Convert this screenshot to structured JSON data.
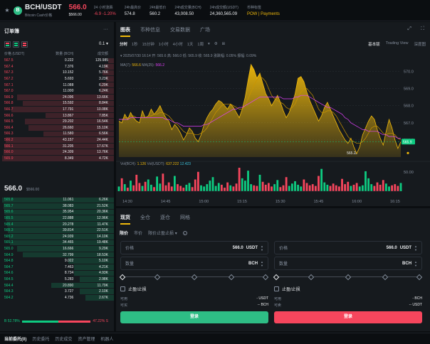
{
  "header": {
    "pair": "BCH/USDT",
    "coin_letter": "B",
    "coin_name": "Bitcoin Cash价格",
    "last_price": "566.0",
    "last_price_sub": "$566.00",
    "stats": [
      {
        "label": "24 小时涨跌",
        "value": "-6.9 -1.20%",
        "color": "#f6465d"
      },
      {
        "label": "24h最高价",
        "value": "574.8",
        "color": "#eaecef"
      },
      {
        "label": "24h最低价",
        "value": "560.2",
        "color": "#eaecef"
      },
      {
        "label": "24h成交量(BCH)",
        "value": "43,008.50",
        "color": "#eaecef"
      },
      {
        "label": "24h成交额(USDT)",
        "value": "24,360,565.09",
        "color": "#eaecef"
      },
      {
        "label": "币种标签",
        "value": "POW | Payments",
        "color": "#f0b90b"
      }
    ]
  },
  "orderbook": {
    "title": "订单簿",
    "more": "···",
    "precision": "0.1 ▾",
    "columns": [
      "价格 (USDT)",
      "数量 (BCH)",
      "成交额"
    ],
    "asks": [
      [
        "567.5",
        "0.222",
        "125.985",
        0.05
      ],
      [
        "567.4",
        "7.376",
        "4.19K",
        0.08
      ],
      [
        "567.3",
        "10.152",
        "5.76K",
        0.1
      ],
      [
        "567.2",
        "5.693",
        "3.23K",
        0.07
      ],
      [
        "567.1",
        "11.088",
        "6.29K",
        0.12
      ],
      [
        "567.0",
        "11.000",
        "6.24K",
        0.12
      ],
      [
        "566.9",
        "24.096",
        "13.66K",
        0.85
      ],
      [
        "566.8",
        "15.592",
        "8.84K",
        0.8
      ],
      [
        "566.7",
        "17.791",
        "10.08K",
        0.9
      ],
      [
        "566.6",
        "13.867",
        "7.85K",
        0.6
      ],
      [
        "566.5",
        "29.202",
        "16.54K",
        0.78
      ],
      [
        "566.4",
        "26.660",
        "15.10K",
        0.75
      ],
      [
        "566.3",
        "11.580",
        "6.56K",
        0.62
      ],
      [
        "566.2",
        "43.157",
        "24.44K",
        0.95
      ],
      [
        "566.1",
        "31.205",
        "17.67K",
        0.96
      ],
      [
        "566.0",
        "24.309",
        "13.76K",
        0.97
      ],
      [
        "565.9",
        "8.349",
        "4.72K",
        0.98
      ]
    ],
    "mid_price": "566.0",
    "mid_sub": "$566.00",
    "bids": [
      [
        "565.8",
        "11.061",
        "6.26K",
        0.98
      ],
      [
        "565.7",
        "38.083",
        "21.52K",
        0.97
      ],
      [
        "565.6",
        "35.954",
        "20.36K",
        0.96
      ],
      [
        "565.5",
        "22.888",
        "12.96K",
        0.95
      ],
      [
        "565.4",
        "20.278",
        "11.47K",
        0.94
      ],
      [
        "565.3",
        "39.814",
        "22.51K",
        0.93
      ],
      [
        "565.2",
        "24.939",
        "14.10K",
        0.92
      ],
      [
        "565.1",
        "34.465",
        "19.48K",
        0.91
      ],
      [
        "565.0",
        "16.666",
        "9.29K",
        0.85
      ],
      [
        "564.9",
        "32.799",
        "18.53K",
        0.8
      ],
      [
        "564.8",
        "9.022",
        "5.10K",
        0.4
      ],
      [
        "564.7",
        "7.463",
        "4.21K",
        0.35
      ],
      [
        "564.6",
        "8.734",
        "4.93K",
        0.35
      ],
      [
        "564.5",
        "5.283",
        "2.98K",
        0.3
      ],
      [
        "564.4",
        "20.890",
        "11.79K",
        0.55
      ],
      [
        "564.3",
        "3.727",
        "2.10K",
        0.3
      ],
      [
        "564.2",
        "4.736",
        "2.67K",
        0.25
      ]
    ],
    "ratio_buy": "B 52.78%",
    "ratio_sell": "47.22% S",
    "ratio_value": 52.78
  },
  "chart": {
    "tabs": [
      "图表",
      "币种信息",
      "交易数据",
      "广场"
    ],
    "intervals": [
      "分时",
      "1秒",
      "15分钟",
      "1小时",
      "4小时",
      "1天",
      "1周",
      "▾"
    ],
    "tools": [
      "⚙",
      "⊞"
    ],
    "views": [
      "基本版",
      "Trading View",
      "深度图"
    ],
    "ohlc": "▾ 2025/07/30 16:14  开: 565.6  高: 566.0  低: 565.9  收: 565.9  涨跌幅: 0.05%  振幅: 0.09%",
    "ma_label": "MA(7):",
    "ma7": "566.6",
    "ma25_label": "MA(25):",
    "ma25": "566.2",
    "vol_label": "Vol(BCH):",
    "vol_bch": "1.126",
    "vol_usdt_label": "Vol(USDT):",
    "vol_usdt": "637.222",
    "vol_extra": "12.423",
    "low_marker": "565.2",
    "current_tag": "565.9"
  },
  "chart_data": {
    "type": "area",
    "x_ticks": [
      "14:30",
      "14:45",
      "15:00",
      "15:15",
      "15:30",
      "15:45",
      "16:00",
      "16:15"
    ],
    "y_ticks": [
      570.0,
      569.0,
      568.0,
      567.0,
      566.0
    ],
    "ylim": [
      565.0,
      570.6
    ],
    "vol_tick": "50.00",
    "price": [
      567.1,
      567.0,
      567.5,
      567.2,
      567.6,
      567.3,
      567.1,
      567.0,
      567.7,
      567.3,
      567.4,
      567.8,
      567.5,
      567.7,
      568.0,
      567.6,
      567.3,
      567.1,
      566.6,
      566.9,
      566.7,
      566.4,
      566.0,
      566.3,
      566.7,
      566.5,
      566.1,
      565.9,
      566.3,
      566.9,
      567.3,
      567.6,
      567.8,
      568.1,
      568.3,
      568.2,
      568.0,
      567.8,
      568.1,
      567.9,
      567.6,
      567.3,
      567.8,
      568.5,
      569.5,
      570.4,
      570.1,
      569.6,
      569.9,
      569.3,
      568.7,
      568.4,
      568.0,
      568.3,
      568.6,
      568.2,
      567.7,
      567.3,
      567.6,
      568.1,
      568.7,
      569.6,
      569.7,
      569.4,
      568.8,
      568.3,
      567.9,
      567.5,
      567.1,
      567.4,
      567.9,
      568.2,
      567.8,
      567.4,
      567.0,
      566.6,
      566.3,
      566.0,
      565.8,
      566.1,
      565.6,
      565.2,
      565.6,
      566.3,
      566.7,
      567.1,
      567.4,
      567.2,
      566.6,
      566.1,
      565.7,
      566.5,
      567.2,
      566.7,
      566.0,
      565.5,
      565.9
    ],
    "ma7": [
      567.2,
      567.2,
      567.3,
      567.3,
      567.4,
      567.4,
      567.3,
      567.3,
      567.3,
      567.3,
      567.4,
      567.4,
      567.5,
      567.5,
      567.6,
      567.6,
      567.5,
      567.4,
      567.2,
      567.0,
      566.9,
      566.7,
      566.5,
      566.4,
      566.4,
      566.4,
      566.3,
      566.3,
      566.4,
      566.5,
      566.7,
      567.0,
      567.3,
      567.6,
      567.8,
      568.0,
      568.1,
      568.1,
      568.1,
      568.0,
      567.9,
      567.8,
      567.8,
      568.0,
      568.4,
      568.8,
      569.2,
      569.5,
      569.7,
      569.6,
      569.4,
      569.0,
      568.6,
      568.4,
      568.3,
      568.2,
      568.1,
      567.9,
      567.8,
      567.9,
      568.1,
      568.5,
      568.8,
      569.0,
      569.0,
      568.8,
      568.6,
      568.2,
      567.8,
      567.6,
      567.6,
      567.7,
      567.7,
      567.6,
      567.4,
      567.1,
      566.8,
      566.5,
      566.2,
      566.0,
      565.9,
      565.8,
      565.8,
      565.9,
      566.1,
      566.4,
      566.7,
      566.8,
      566.8,
      566.6,
      566.4,
      566.3,
      566.4,
      566.4,
      566.3,
      566.1,
      566.0
    ],
    "ma25": [
      567.2,
      567.2,
      567.2,
      567.2,
      567.3,
      567.3,
      567.3,
      567.3,
      567.3,
      567.3,
      567.3,
      567.3,
      567.3,
      567.3,
      567.3,
      567.3,
      567.2,
      567.2,
      567.1,
      567.0,
      567.0,
      566.9,
      566.8,
      566.8,
      566.8,
      566.8,
      566.8,
      566.8,
      566.8,
      566.9,
      566.9,
      567.0,
      567.1,
      567.2,
      567.3,
      567.4,
      567.5,
      567.6,
      567.7,
      567.8,
      567.8,
      567.9,
      567.9,
      568.0,
      568.1,
      568.2,
      568.3,
      568.4,
      568.5,
      568.5,
      568.5,
      568.5,
      568.5,
      568.5,
      568.5,
      568.5,
      568.4,
      568.4,
      568.4,
      568.4,
      568.5,
      568.5,
      568.6,
      568.6,
      568.6,
      568.5,
      568.4,
      568.3,
      568.2,
      568.1,
      568.0,
      567.9,
      567.9,
      567.8,
      567.7,
      567.6,
      567.5,
      567.3,
      567.2,
      567.0,
      566.9,
      566.8,
      566.7,
      566.6,
      566.6,
      566.5,
      566.5,
      566.5,
      566.5,
      566.4,
      566.3,
      566.3,
      566.2,
      566.2,
      566.2,
      566.1,
      566.1
    ],
    "volume": [
      8,
      22,
      12,
      6,
      18,
      10,
      28,
      14,
      9,
      16,
      20,
      11,
      7,
      25,
      13,
      30,
      10,
      15,
      8,
      26,
      12,
      9,
      6,
      11,
      14,
      7,
      20,
      33,
      10,
      8,
      12,
      18,
      24,
      9,
      14,
      11,
      6,
      15,
      10,
      8,
      13,
      40,
      22,
      18,
      35,
      12,
      10,
      9,
      28,
      16,
      11,
      14,
      8,
      12,
      19,
      7,
      10,
      24,
      9,
      13,
      17,
      11,
      8,
      20,
      14,
      10,
      12,
      9,
      26,
      38,
      15,
      11,
      9,
      13,
      10,
      8,
      21,
      12,
      16,
      9,
      11,
      14,
      8,
      10,
      34,
      22,
      12,
      9,
      15,
      11,
      19,
      13,
      8,
      10,
      12,
      9,
      14
    ]
  },
  "trade": {
    "tabs": [
      "现货",
      "全仓",
      "逐仓",
      "网格"
    ],
    "order_types": [
      "限价",
      "市价",
      "限价止盈止损 ▾"
    ],
    "info": "i",
    "buy": {
      "price_label": "价格",
      "price_value": "566.0",
      "price_unit": "USDT",
      "qty_label": "数量",
      "qty_unit": "BCH",
      "tpsl": "止盈/止损",
      "avail_label": "可用",
      "avail_value": "- USDT",
      "max_label": "可买",
      "max_value": "-- BCH",
      "button": "登录"
    },
    "sell": {
      "price_label": "价格",
      "price_value": "566.0",
      "price_unit": "USDT",
      "qty_label": "数量",
      "qty_unit": "BCH",
      "tpsl": "止盈/止损",
      "avail_label": "可用",
      "avail_value": "- BCH",
      "max_label": "可卖",
      "max_value": "-- USDT",
      "button": "登录"
    }
  },
  "bottom": {
    "tabs": [
      "当前委托(0)",
      "历史委托",
      "历史成交",
      "资产管理",
      "机器人"
    ]
  },
  "colors": {
    "up": "#0ecb81",
    "down": "#f6465d",
    "accent": "#f0b90b",
    "ma25": "#e040fb"
  }
}
